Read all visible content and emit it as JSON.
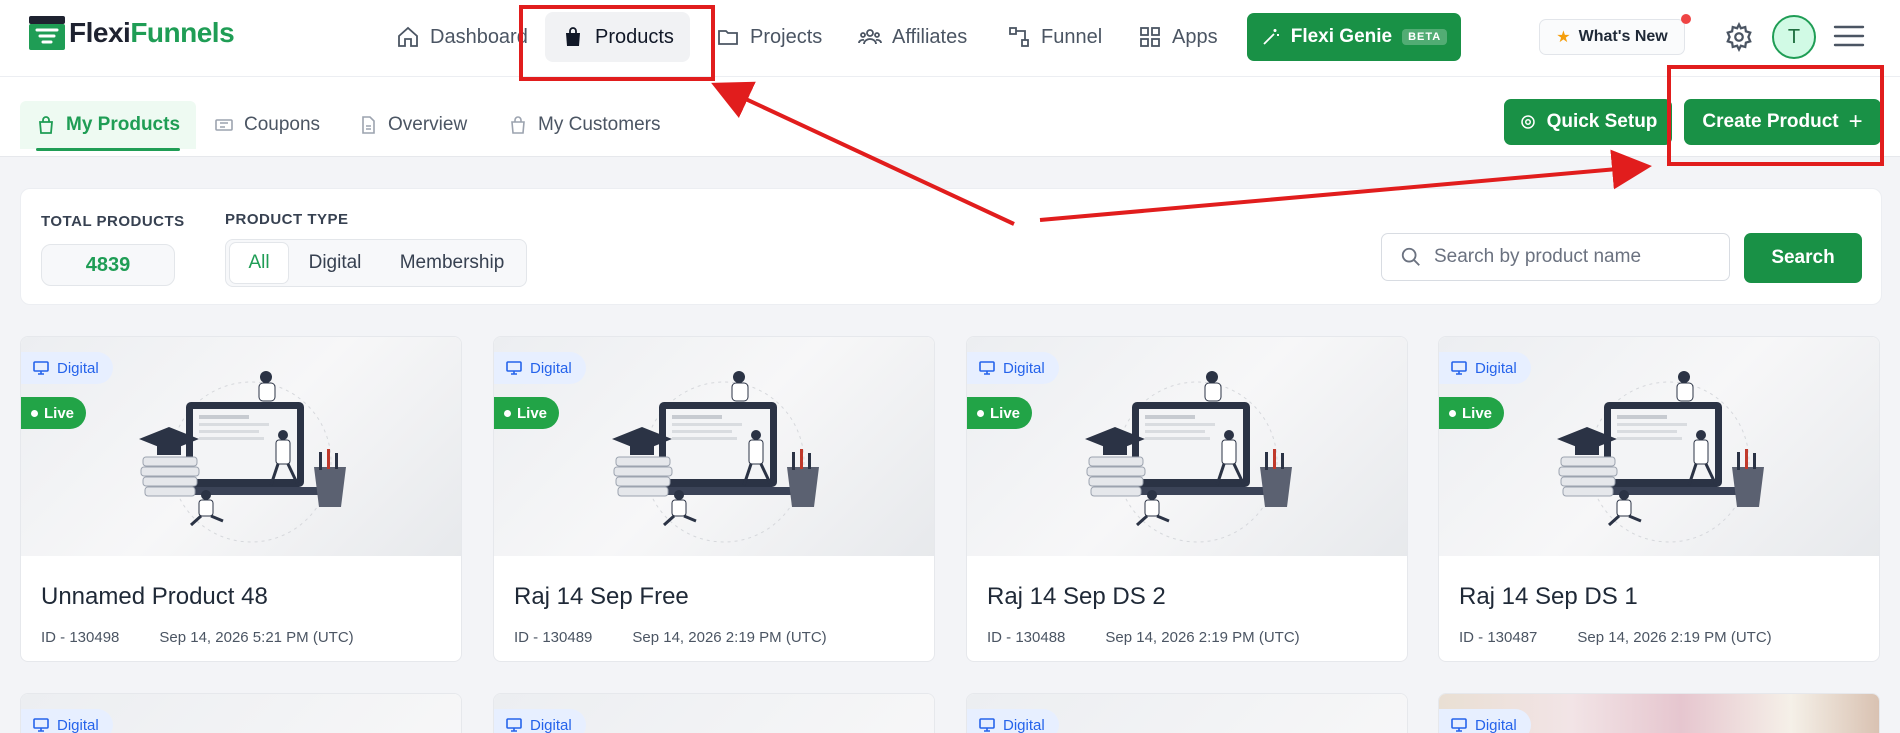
{
  "brand": {
    "part1": "Flexi",
    "part2": "Funnels"
  },
  "nav": {
    "dashboard": "Dashboard",
    "products": "Products",
    "projects": "Projects",
    "affiliates": "Affiliates",
    "funnel": "Funnel",
    "apps": "Apps",
    "genie": "Flexi Genie",
    "beta": "BETA",
    "whats_new": "What's New",
    "avatar_initial": "T"
  },
  "subnav": {
    "my_products": "My Products",
    "coupons": "Coupons",
    "overview": "Overview",
    "my_customers": "My Customers",
    "quick_setup": "Quick Setup",
    "create_product": "Create Product"
  },
  "filters": {
    "total_label": "TOTAL PRODUCTS",
    "total_value": "4839",
    "type_label": "PRODUCT TYPE",
    "type_all": "All",
    "type_digital": "Digital",
    "type_membership": "Membership",
    "search_placeholder": "Search by product name",
    "search_button": "Search"
  },
  "products": [
    {
      "type": "Digital",
      "status": "Live",
      "title": "Unnamed Product 48",
      "id": "ID - 130498",
      "date": "Sep 14, 2026 5:21 PM (UTC)"
    },
    {
      "type": "Digital",
      "status": "Live",
      "title": "Raj 14 Sep Free",
      "id": "ID - 130489",
      "date": "Sep 14, 2026 2:19 PM (UTC)"
    },
    {
      "type": "Digital",
      "status": "Live",
      "title": "Raj 14 Sep DS 2",
      "id": "ID - 130488",
      "date": "Sep 14, 2026 2:19 PM (UTC)"
    },
    {
      "type": "Digital",
      "status": "Live",
      "title": "Raj 14 Sep DS 1",
      "id": "ID - 130487",
      "date": "Sep 14, 2026 2:19 PM (UTC)"
    }
  ],
  "products_row2": [
    {
      "type": "Digital"
    },
    {
      "type": "Digital"
    },
    {
      "type": "Digital"
    },
    {
      "type": "Digital"
    }
  ],
  "colors": {
    "brand_green": "#199146",
    "annotation_red": "#e11d1d",
    "type_blue": "#2563eb"
  }
}
